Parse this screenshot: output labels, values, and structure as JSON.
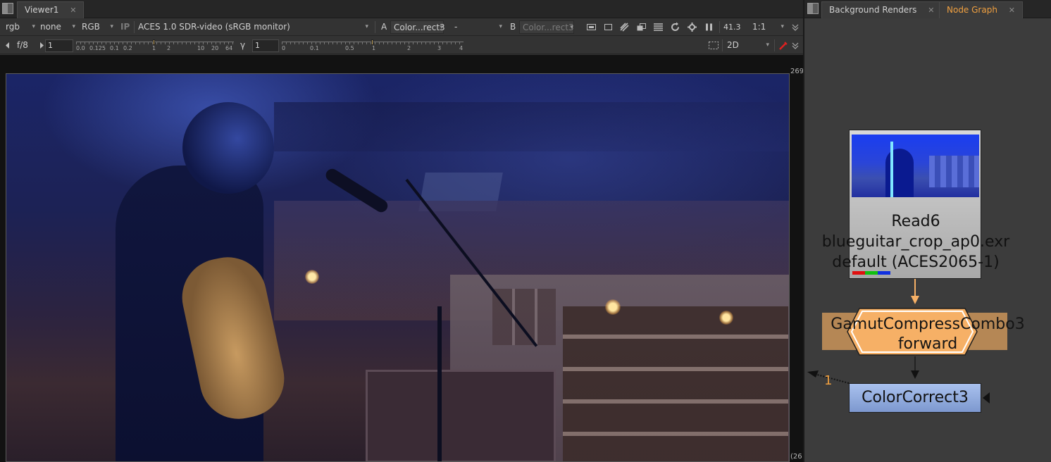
{
  "viewer": {
    "tab_label": "Viewer1",
    "tab_close": "✕",
    "toolbar1": {
      "channels": "rgb",
      "matte": "none",
      "display_channels": "RGB",
      "ip_label": "IP",
      "view_transform": "ACES 1.0 SDR-video (sRGB monitor)",
      "a_label": "A",
      "a_input": "Color...rect3",
      "composite": "-",
      "b_label": "B",
      "b_input": "Color...rect3",
      "zoom_value": "41.3",
      "ratio": "1:1"
    },
    "toolbar2": {
      "fstop": "f/8",
      "frame_value": "1",
      "gain_ticks": [
        "0.0",
        "0.125",
        "0.1",
        "0.2",
        "1",
        "2",
        "10",
        "20",
        "64"
      ],
      "gamma_label": "γ",
      "gamma_value": "1",
      "gamma_ticks": [
        "0",
        "0.1",
        "0.5",
        "1",
        "2",
        "3",
        "4"
      ],
      "view_mode": "2D"
    },
    "format_top_right": "269",
    "format_bottom_right": "(26"
  },
  "graph": {
    "tabs": [
      {
        "label": "Background Renders",
        "close": "✕"
      },
      {
        "label": "Node Graph",
        "close": "✕"
      }
    ],
    "read_node": {
      "name": "Read6",
      "file": "blueguitar_crop_ap0.exr",
      "colorspace": "default (ACES2065-1)"
    },
    "gamut_node": {
      "name": "GamutCompressCombo3",
      "mode": "forward"
    },
    "cc_node": {
      "name": "ColorCorrect3"
    },
    "input_number": "1"
  },
  "colors": {
    "accent": "#f0a040",
    "read_node_bg": "#c0c0c0",
    "gamut_node": "#f6b066",
    "colorcorrect_node": "#8faadf"
  }
}
